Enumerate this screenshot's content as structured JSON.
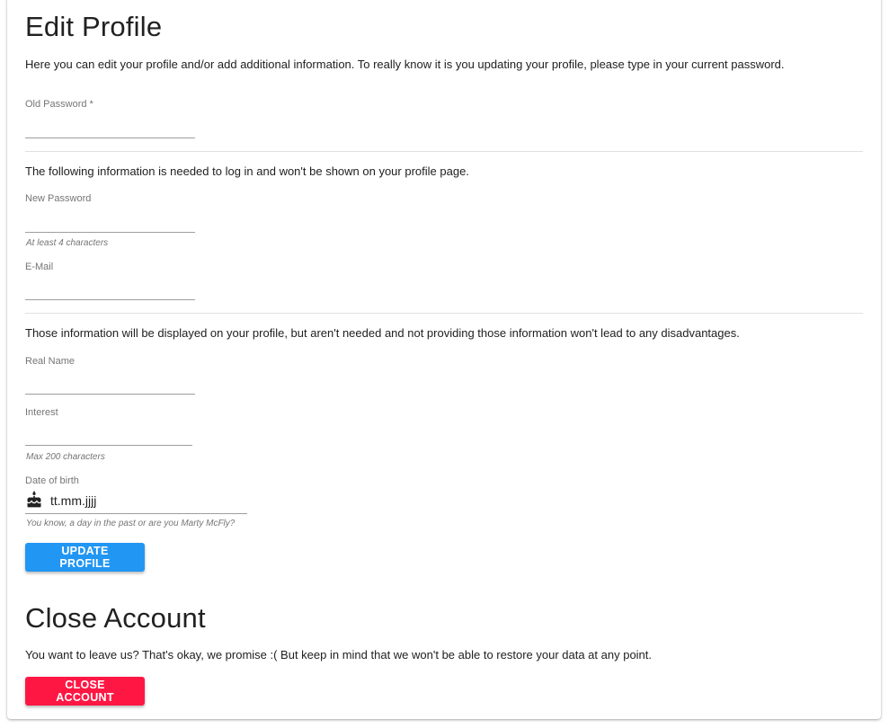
{
  "colors": {
    "primary": "#2196f3",
    "danger": "#ff1744",
    "text": "#212121",
    "muted": "#757575"
  },
  "edit_profile": {
    "title": "Edit Profile",
    "intro": "Here you can edit your profile and/or add additional information. To really know it is you updating your profile, please type in your current password.",
    "old_password": {
      "label": "Old Password *",
      "icon": "lock-icon",
      "value": ""
    },
    "login_info_text": "The following information is needed to log in and won't be shown on your profile page.",
    "new_password": {
      "label": "New Password",
      "icon": "lock-icon",
      "value": "",
      "hint": "At least 4 characters"
    },
    "email": {
      "label": "E-Mail",
      "icon": "email-icon",
      "value": ""
    },
    "profile_info_text": "Those information will be displayed on your profile, but aren't needed and not providing those information won't lead to any disadvantages.",
    "real_name": {
      "label": "Real Name",
      "icon": "face-icon",
      "value": ""
    },
    "interest": {
      "label": "Interest",
      "icon": "smiley-icon",
      "value": "",
      "hint": "Max 200 characters"
    },
    "date_of_birth": {
      "label": "Date of birth",
      "icon": "cake-icon",
      "placeholder": "tt.mm.jjjj",
      "hint": "You know, a day in the past or are you Marty McFly?"
    },
    "update_button": "UPDATE PROFILE"
  },
  "close_account": {
    "title": "Close Account",
    "text": "You want to leave us? That's okay, we promise :( But keep in mind that we won't be able to restore your data at any point.",
    "button": "CLOSE ACCOUNT"
  }
}
